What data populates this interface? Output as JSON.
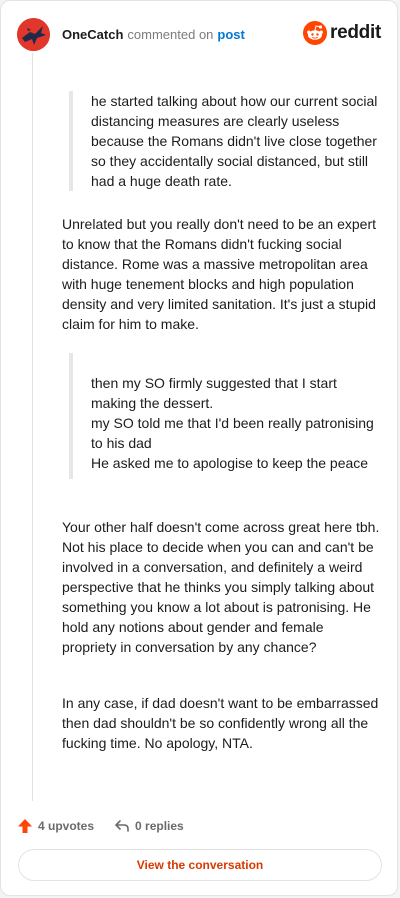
{
  "header": {
    "author": "OneCatch",
    "action": "commented on",
    "target": "post",
    "brand": "reddit"
  },
  "quote1": {
    "text": "he started talking about how our current social distancing measures are clearly useless because the Romans didn't live close together so they accidentally social distanced, but still had a huge death rate."
  },
  "paragraph1": "Unrelated but you really don't need to be an expert to know that the Romans didn't fucking social distance. Rome was a massive metropolitan area with huge tenement blocks and high population density and very limited sanitation. It's just a stupid claim for him to make.",
  "quote2": {
    "line1": "then my SO firmly suggested that I start making the dessert.",
    "line2": "my SO told me that I'd been really patronising to his dad",
    "line3": "He asked me to apologise to keep the peace"
  },
  "paragraph2": "Your other half doesn't come across great here tbh. Not his place to decide when you can and can't be involved in a conversation, and definitely a weird perspective that he thinks you simply talking about something you know a lot about is patronising. He hold any notions about gender and female propriety in conversation by any chance?",
  "paragraph3": "In any case, if dad doesn't want to be embarrassed then dad shouldn't be so confidently wrong all the fucking time. No apology, NTA.",
  "footer": {
    "upvotes": "4 upvotes",
    "replies": "0 replies"
  },
  "cta": {
    "label": "View the conversation"
  },
  "colors": {
    "accent": "#d93a00",
    "link": "#0079d3",
    "upvote": "#ff4500"
  }
}
